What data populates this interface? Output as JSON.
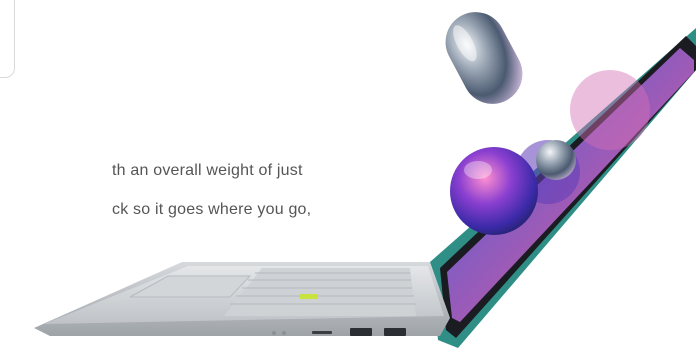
{
  "text": {
    "line1": "th an overall weight of just",
    "line2": "ck so it goes where you go,"
  },
  "product": {
    "image": "laptop-image",
    "accent_colors": {
      "lid_edge": "#2f8f87",
      "screen_purple": "#7b5cc5",
      "screen_pink": "#c05aa8",
      "keyboard_highlight": "#c9e23d"
    }
  }
}
